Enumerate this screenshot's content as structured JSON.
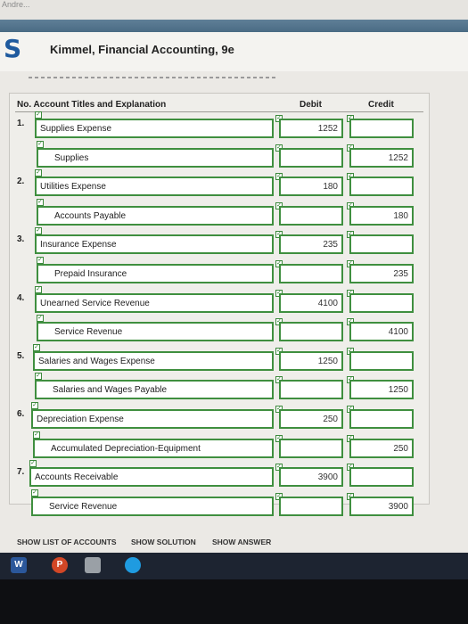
{
  "browser": {
    "tab_title": "Andre..."
  },
  "header": {
    "logo": "S",
    "book_title": "Kimmel, Financial Accounting, 9e"
  },
  "table": {
    "headers": {
      "no_account": "No. Account Titles and Explanation",
      "debit": "Debit",
      "credit": "Credit"
    },
    "entries": [
      {
        "number": "1.",
        "debit_account": "Supplies Expense",
        "debit_amount": "1252",
        "credit_account": "Supplies",
        "credit_amount": "1252"
      },
      {
        "number": "2.",
        "debit_account": "Utilities Expense",
        "debit_amount": "180",
        "credit_account": "Accounts Payable",
        "credit_amount": "180"
      },
      {
        "number": "3.",
        "debit_account": "Insurance Expense",
        "debit_amount": "235",
        "credit_account": "Prepaid Insurance",
        "credit_amount": "235"
      },
      {
        "number": "4.",
        "debit_account": "Unearned Service Revenue",
        "debit_amount": "4100",
        "credit_account": "Service Revenue",
        "credit_amount": "4100"
      },
      {
        "number": "5.",
        "debit_account": "Salaries and Wages Expense",
        "debit_amount": "1250",
        "credit_account": "Salaries and Wages Payable",
        "credit_amount": "1250"
      },
      {
        "number": "6.",
        "debit_account": "Depreciation Expense",
        "debit_amount": "250",
        "credit_account": "Accumulated Depreciation-Equipment",
        "credit_amount": "250"
      },
      {
        "number": "7.",
        "debit_account": "Accounts Receivable",
        "debit_amount": "3900",
        "credit_account": "Service Revenue",
        "credit_amount": "3900"
      }
    ]
  },
  "buttons": {
    "show_list": "SHOW LIST OF ACCOUNTS",
    "show_solution": "SHOW SOLUTION",
    "show_answer": "SHOW ANSWER"
  },
  "taskbar": {
    "apps": [
      {
        "icon": "word-icon",
        "label": "W",
        "color": "#2b579a"
      },
      {
        "icon": "powerpoint-icon",
        "label": "P",
        "color": "#d24726"
      },
      {
        "icon": "calculator-icon",
        "label": "",
        "color": "#9aa0a6"
      },
      {
        "icon": "edge-icon",
        "label": "",
        "color": "#1f9be0"
      }
    ]
  }
}
